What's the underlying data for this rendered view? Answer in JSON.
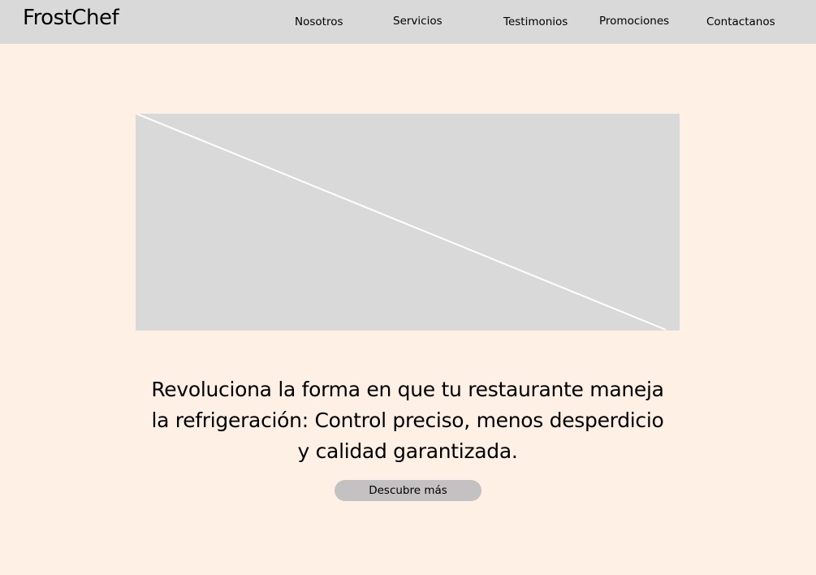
{
  "header": {
    "logo": "FrostChef",
    "nav": [
      {
        "label": "Nosotros"
      },
      {
        "label": "Servicios"
      },
      {
        "label": "Testimonios"
      },
      {
        "label": "Promociones"
      },
      {
        "label": "Contactanos"
      }
    ]
  },
  "hero": {
    "image_placeholder_icon": "image-placeholder-icon",
    "headline_lines": [
      "Revoluciona la forma en que tu restaurante maneja",
      "la refrigeración: Control preciso, menos desperdicio",
      "y calidad garantizada."
    ],
    "cta_label": "Descubre más"
  },
  "colors": {
    "background": "#FFF0E6",
    "navbar": "#D9D9D9",
    "placeholder": "#D9D9D9",
    "button": "#C4C1C3",
    "text": "#000000"
  }
}
